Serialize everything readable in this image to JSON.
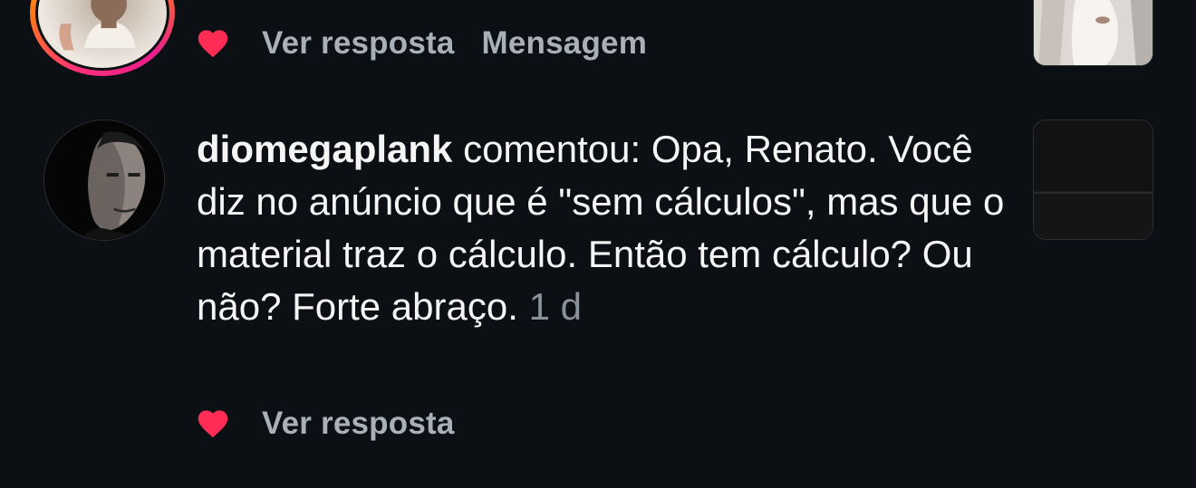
{
  "top_notification": {
    "actions": {
      "reply_label": "Ver resposta",
      "message_label": "Mensagem"
    }
  },
  "comment": {
    "username": "diomegaplank",
    "text": " comentou: Opa, Renato. Você diz no anúncio que é \"sem cálculos\", mas que o material traz o cálculo. Então tem cálculo? Ou não? Forte abraço. ",
    "time": "1 d",
    "actions": {
      "reply_label": "Ver resposta"
    }
  },
  "icons": {
    "like": "heart-icon"
  },
  "colors": {
    "background": "#0c1014",
    "heart": "#ff2d55",
    "muted_text": "#a8b0b8",
    "timestamp": "#8a939c",
    "text": "#f5f5f5"
  }
}
